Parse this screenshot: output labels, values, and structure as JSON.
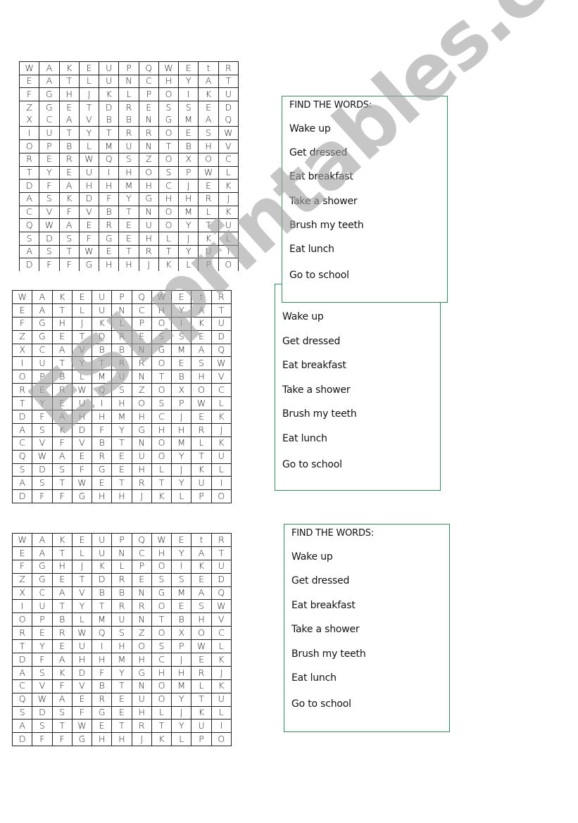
{
  "puzzles": [
    {
      "grid": [
        [
          "W",
          "A",
          "K",
          "E",
          "U",
          "P",
          "Q",
          "W",
          "E",
          "t",
          "R"
        ],
        [
          "E",
          "A",
          "T",
          "L",
          "U",
          "N",
          "C",
          "H",
          "Y",
          "A",
          "T"
        ],
        [
          "F",
          "G",
          "H",
          "J",
          "K",
          "L",
          "P",
          "O",
          "I",
          "K",
          "U"
        ],
        [
          "Z",
          "G",
          "E",
          "T",
          "D",
          "R",
          "E",
          "S",
          "S",
          "E",
          "D"
        ],
        [
          "X",
          "C",
          "A",
          "V",
          "B",
          "B",
          "N",
          "G",
          "M",
          "A",
          "Q"
        ],
        [
          "I",
          "U",
          "T",
          "Y",
          "T",
          "R",
          "R",
          "O",
          "E",
          "S",
          "W"
        ],
        [
          "O",
          "P",
          "B",
          "L",
          "M",
          "U",
          "N",
          "T",
          "B",
          "H",
          "V"
        ],
        [
          "R",
          "E",
          "R",
          "W",
          "Q",
          "S",
          "Z",
          "O",
          "X",
          "O",
          "C"
        ],
        [
          "T",
          "Y",
          "E",
          "U",
          "I",
          "H",
          "O",
          "S",
          "P",
          "W",
          "L"
        ],
        [
          "D",
          "F",
          "A",
          "H",
          "H",
          "M",
          "H",
          "C",
          "J",
          "E",
          "K"
        ],
        [
          "A",
          "S",
          "K",
          "D",
          "F",
          "Y",
          "G",
          "H",
          "H",
          "R",
          "J"
        ],
        [
          "C",
          "V",
          "F",
          "V",
          "B",
          "T",
          "N",
          "O",
          "M",
          "L",
          "K"
        ],
        [
          "Q",
          "W",
          "A",
          "E",
          "R",
          "E",
          "U",
          "O",
          "Y",
          "T",
          "U"
        ],
        [
          "S",
          "D",
          "S",
          "F",
          "G",
          "E",
          "H",
          "L",
          "J",
          "K",
          "L"
        ],
        [
          "A",
          "S",
          "T",
          "W",
          "E",
          "T",
          "R",
          "T",
          "Y",
          "U",
          "I"
        ],
        [
          "D",
          "F",
          "F",
          "G",
          "H",
          "H",
          "J",
          "K",
          "L",
          "P",
          "O"
        ]
      ],
      "word_box": {
        "title": "FIND THE WORDS:",
        "words": [
          "Wake up",
          "Get dressed",
          "Eat breakfast",
          "Take a shower",
          "Brush my teeth",
          "Eat lunch",
          "Go to school"
        ]
      }
    },
    {
      "grid": [
        [
          "W",
          "A",
          "K",
          "E",
          "U",
          "P",
          "Q",
          "W",
          "E",
          "t",
          "R"
        ],
        [
          "E",
          "A",
          "T",
          "L",
          "U",
          "N",
          "C",
          "H",
          "Y",
          "A",
          "T"
        ],
        [
          "F",
          "G",
          "H",
          "J",
          "K",
          "L",
          "P",
          "O",
          "I",
          "K",
          "U"
        ],
        [
          "Z",
          "G",
          "E",
          "T",
          "D",
          "R",
          "E",
          "S",
          "S",
          "E",
          "D"
        ],
        [
          "X",
          "C",
          "A",
          "V",
          "B",
          "B",
          "N",
          "G",
          "M",
          "A",
          "Q"
        ],
        [
          "I",
          "U",
          "T",
          "Y",
          "T",
          "R",
          "R",
          "O",
          "E",
          "S",
          "W"
        ],
        [
          "O",
          "P",
          "B",
          "L",
          "M",
          "U",
          "N",
          "T",
          "B",
          "H",
          "V"
        ],
        [
          "R",
          "E",
          "R",
          "W",
          "Q",
          "S",
          "Z",
          "O",
          "X",
          "O",
          "C"
        ],
        [
          "T",
          "Y",
          "E",
          "U",
          "I",
          "H",
          "O",
          "S",
          "P",
          "W",
          "L"
        ],
        [
          "D",
          "F",
          "A",
          "H",
          "H",
          "M",
          "H",
          "C",
          "J",
          "E",
          "K"
        ],
        [
          "A",
          "S",
          "K",
          "D",
          "F",
          "Y",
          "G",
          "H",
          "H",
          "R",
          "J"
        ],
        [
          "C",
          "V",
          "F",
          "V",
          "B",
          "T",
          "N",
          "O",
          "M",
          "L",
          "K"
        ],
        [
          "Q",
          "W",
          "A",
          "E",
          "R",
          "E",
          "U",
          "O",
          "Y",
          "T",
          "U"
        ],
        [
          "S",
          "D",
          "S",
          "F",
          "G",
          "E",
          "H",
          "L",
          "J",
          "K",
          "L"
        ],
        [
          "A",
          "S",
          "T",
          "W",
          "E",
          "T",
          "R",
          "T",
          "Y",
          "U",
          "I"
        ],
        [
          "D",
          "F",
          "F",
          "G",
          "H",
          "H",
          "J",
          "K",
          "L",
          "P",
          "O"
        ]
      ],
      "word_box": {
        "title": "",
        "words": [
          "Wake up",
          "Get dressed",
          "Eat breakfast",
          "Take a shower",
          "Brush my teeth",
          "Eat lunch",
          "Go to school"
        ]
      }
    },
    {
      "grid": [
        [
          "W",
          "A",
          "K",
          "E",
          "U",
          "P",
          "Q",
          "W",
          "E",
          "t",
          "R"
        ],
        [
          "E",
          "A",
          "T",
          "L",
          "U",
          "N",
          "C",
          "H",
          "Y",
          "A",
          "T"
        ],
        [
          "F",
          "G",
          "H",
          "J",
          "K",
          "L",
          "P",
          "O",
          "I",
          "K",
          "U"
        ],
        [
          "Z",
          "G",
          "E",
          "T",
          "D",
          "R",
          "E",
          "S",
          "S",
          "E",
          "D"
        ],
        [
          "X",
          "C",
          "A",
          "V",
          "B",
          "B",
          "N",
          "G",
          "M",
          "A",
          "Q"
        ],
        [
          "I",
          "U",
          "T",
          "Y",
          "T",
          "R",
          "R",
          "O",
          "E",
          "S",
          "W"
        ],
        [
          "O",
          "P",
          "B",
          "L",
          "M",
          "U",
          "N",
          "T",
          "B",
          "H",
          "V"
        ],
        [
          "R",
          "E",
          "R",
          "W",
          "Q",
          "S",
          "Z",
          "O",
          "X",
          "O",
          "C"
        ],
        [
          "T",
          "Y",
          "E",
          "U",
          "I",
          "H",
          "O",
          "S",
          "P",
          "W",
          "L"
        ],
        [
          "D",
          "F",
          "A",
          "H",
          "H",
          "M",
          "H",
          "C",
          "J",
          "E",
          "K"
        ],
        [
          "A",
          "S",
          "K",
          "D",
          "F",
          "Y",
          "G",
          "H",
          "H",
          "R",
          "J"
        ],
        [
          "C",
          "V",
          "F",
          "V",
          "B",
          "T",
          "N",
          "O",
          "M",
          "L",
          "K"
        ],
        [
          "Q",
          "W",
          "A",
          "E",
          "R",
          "E",
          "U",
          "O",
          "Y",
          "T",
          "U"
        ],
        [
          "S",
          "D",
          "S",
          "F",
          "G",
          "E",
          "H",
          "L",
          "J",
          "K",
          "L"
        ],
        [
          "A",
          "S",
          "T",
          "W",
          "E",
          "T",
          "R",
          "T",
          "Y",
          "U",
          "I"
        ],
        [
          "D",
          "F",
          "F",
          "G",
          "H",
          "H",
          "J",
          "K",
          "L",
          "P",
          "O"
        ]
      ],
      "word_box": {
        "title": "FIND THE WORDS:",
        "words": [
          "Wake up",
          "Get dressed",
          "Eat breakfast",
          "Take a shower",
          "Brush my teeth",
          "Eat lunch",
          "Go to school"
        ]
      }
    }
  ],
  "watermark": {
    "text": "ESLprintables.com",
    "color": "#a0a0a0"
  },
  "colors": {
    "box_border": "#2e8b57",
    "grid_line": "#222222"
  }
}
